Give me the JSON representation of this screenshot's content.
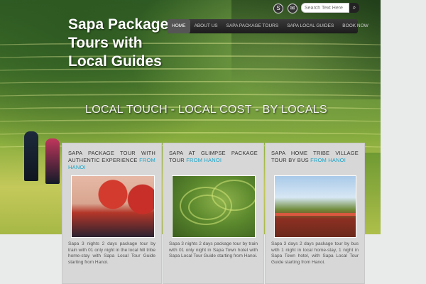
{
  "site": {
    "title": "Sapa Package Tours with Local Guides",
    "tagline": "LOCAL TOUCH - LOCAL COST - BY LOCALS"
  },
  "header": {
    "icons": [
      "skype-icon",
      "email-icon"
    ],
    "search_placeholder": "Search Text Here",
    "search_button": "search-icon"
  },
  "nav": {
    "items": [
      {
        "label": "HOME",
        "active": true
      },
      {
        "label": "ABOUT US"
      },
      {
        "label": "SAPA PACKAGE TOURS"
      },
      {
        "label": "SAPA LOCAL GUIDES"
      },
      {
        "label": "BOOK NOW"
      }
    ]
  },
  "panels": [
    {
      "title": "Sapa package tour with authentic experience",
      "highlight": "from Hanoi",
      "text": "Sapa 3 nights 2 days package tour by train with 01 only night in the local hill tribe home-stay with Sapa Local Tour Guide starting from Hanoi."
    },
    {
      "title": "Sapa at glimpse package tour",
      "highlight": "from Hanoi",
      "text": "Sapa 3 nights 2 days package tour by train with 01 only night in Sapa Town hotel with Sapa Local Tour Guide starting from Hanoi."
    },
    {
      "title": "Sapa home tribe village tour by bus",
      "highlight": "from Hanoi",
      "text": "Sapa 3 days 2 days package tour by bus with 1 night in local home-stay, 1 night in Sapa Town hotel, with Sapa Local Tour Guide starting from Hanoi."
    }
  ],
  "colors": {
    "nav_bg": "#2a2a2a",
    "accent": "#1aa5c8",
    "panel_bg": "#d7d7d7"
  }
}
